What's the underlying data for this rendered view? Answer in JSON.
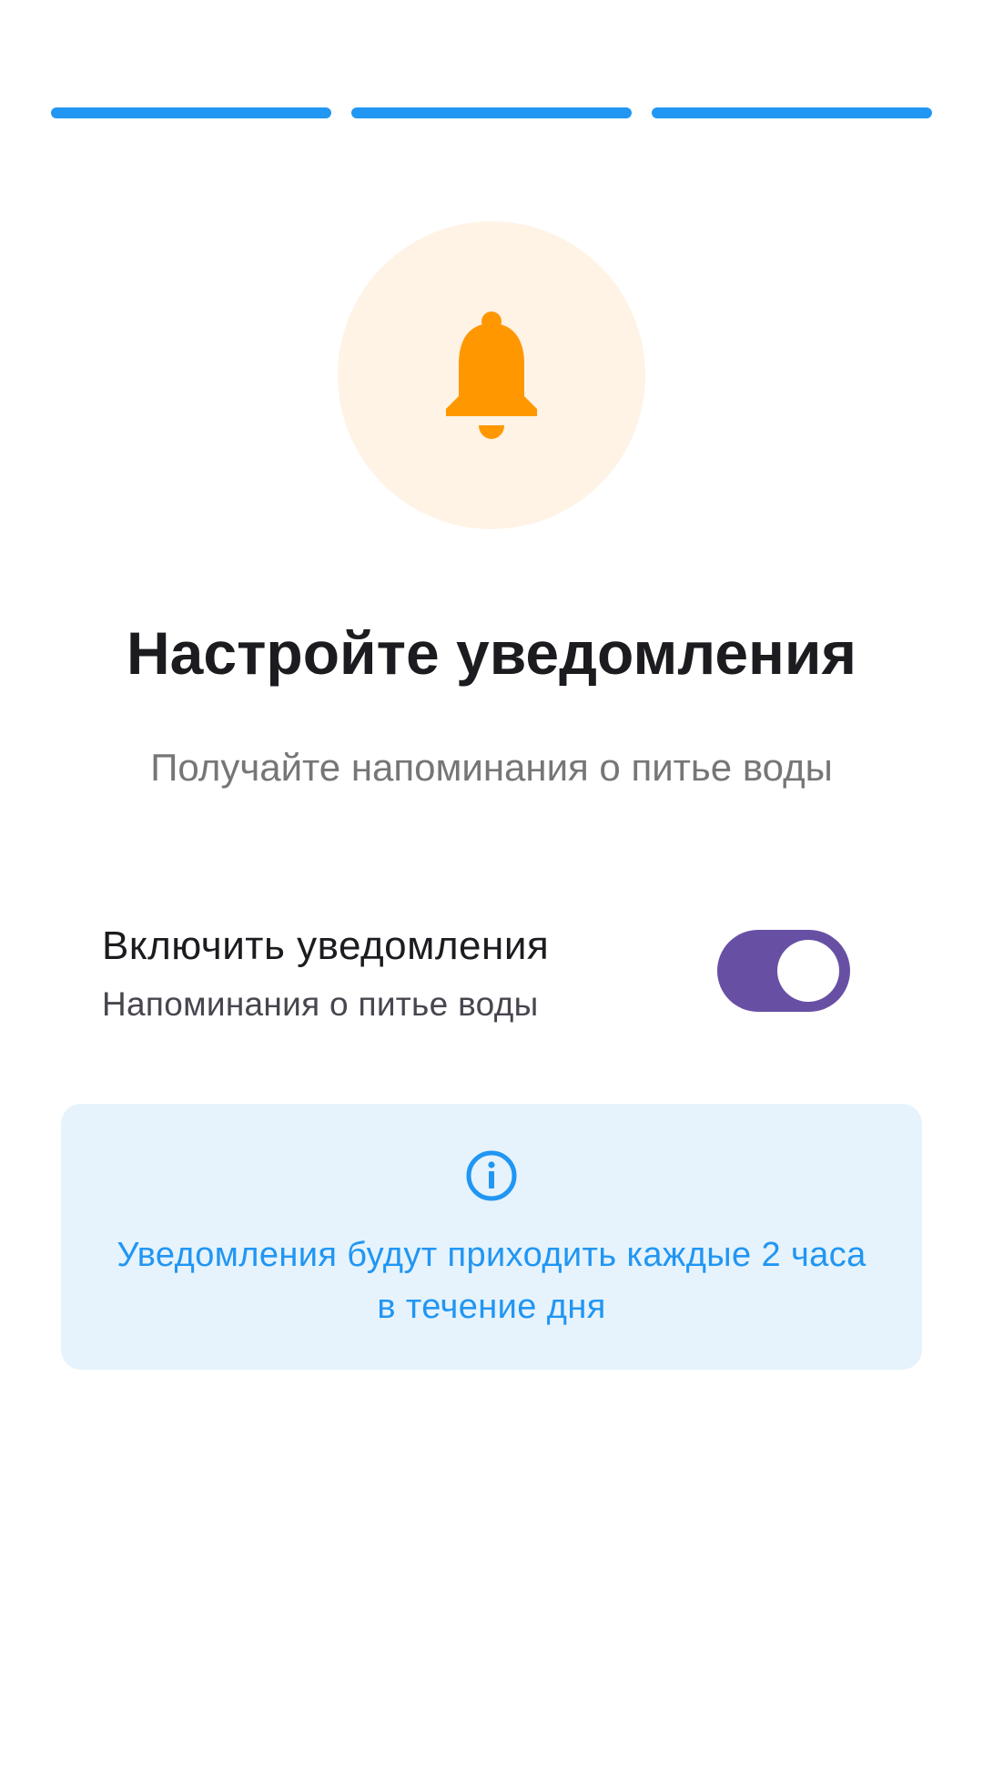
{
  "progress": {
    "steps_total": 3,
    "steps_completed": 3,
    "color": "#2196f3"
  },
  "hero": {
    "icon": "bell-icon",
    "icon_color": "#ff9800",
    "circle_color": "#fef3e5"
  },
  "title": "Настройте уведомления",
  "subtitle": "Получайте напоминания о питье воды",
  "notifications_switch": {
    "label": "Включить уведомления",
    "sublabel": "Напоминания о питье воды",
    "enabled": true,
    "track_color": "#6750a4"
  },
  "info_card": {
    "icon": "info-icon",
    "text": "Уведомления будут приходить каждые 2 часа в течение дня",
    "background": "#e6f3fc",
    "text_color": "#2196f3"
  }
}
